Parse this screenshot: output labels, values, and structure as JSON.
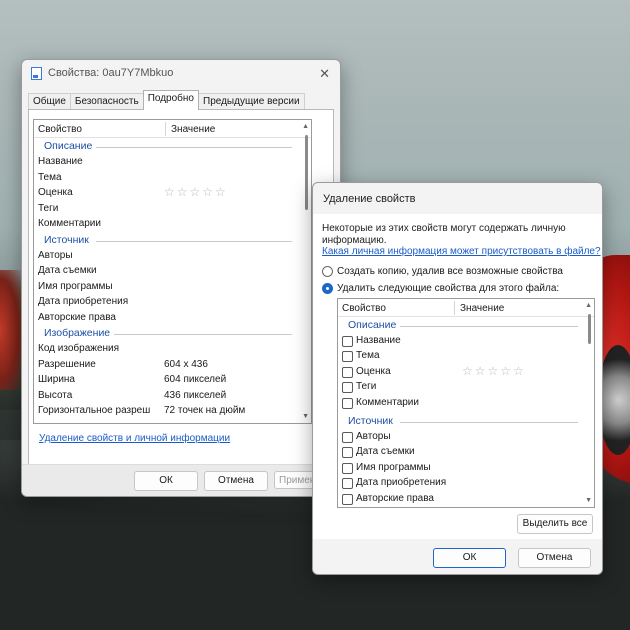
{
  "props_window": {
    "title": "Свойства: 0au7Y7Mbkuo",
    "tabs": [
      {
        "label": "Общие"
      },
      {
        "label": "Безопасность"
      },
      {
        "label": "Подробно"
      },
      {
        "label": "Предыдущие версии"
      }
    ],
    "active_tab": "Подробно",
    "columns": {
      "property": "Свойство",
      "value": "Значение"
    },
    "groups": [
      {
        "title": "Описание",
        "rows": [
          {
            "k": "Название",
            "v": ""
          },
          {
            "k": "Тема",
            "v": ""
          },
          {
            "k": "Оценка",
            "v": "☆☆☆☆☆"
          },
          {
            "k": "Теги",
            "v": ""
          },
          {
            "k": "Комментарии",
            "v": ""
          }
        ]
      },
      {
        "title": "Источник",
        "rows": [
          {
            "k": "Авторы",
            "v": ""
          },
          {
            "k": "Дата съемки",
            "v": ""
          },
          {
            "k": "Имя программы",
            "v": ""
          },
          {
            "k": "Дата приобретения",
            "v": ""
          },
          {
            "k": "Авторские права",
            "v": ""
          }
        ]
      },
      {
        "title": "Изображение",
        "rows": [
          {
            "k": "Код изображения",
            "v": ""
          },
          {
            "k": "Разрешение",
            "v": "604 x 436"
          },
          {
            "k": "Ширина",
            "v": "604 пикселей"
          },
          {
            "k": "Высота",
            "v": "436 пикселей"
          },
          {
            "k": "Горизонтальное разреш",
            "v": "72 точек на дюйм"
          }
        ]
      }
    ],
    "remove_link": "Удаление свойств и личной информации",
    "ok": "ОК",
    "cancel": "Отмена",
    "apply": "Примен"
  },
  "remove_dialog": {
    "title": "Удаление свойств",
    "note": "Некоторые из этих свойств могут содержать личную информацию.",
    "link": "Какая личная информация может присутствовать в файле?",
    "option_copy": "Создать копию, удалив все возможные свойства",
    "option_remove": "Удалить следующие свойства для этого файла:",
    "selected_option": "remove",
    "columns": {
      "property": "Свойство",
      "value": "Значение"
    },
    "groups": [
      {
        "title": "Описание",
        "rows": [
          {
            "k": "Название",
            "v": ""
          },
          {
            "k": "Тема",
            "v": ""
          },
          {
            "k": "Оценка",
            "v": "☆☆☆☆☆"
          },
          {
            "k": "Теги",
            "v": ""
          },
          {
            "k": "Комментарии",
            "v": ""
          }
        ]
      },
      {
        "title": "Источник",
        "rows": [
          {
            "k": "Авторы",
            "v": ""
          },
          {
            "k": "Дата съемки",
            "v": ""
          },
          {
            "k": "Имя программы",
            "v": ""
          },
          {
            "k": "Дата приобретения",
            "v": ""
          },
          {
            "k": "Авторские права",
            "v": ""
          }
        ]
      }
    ],
    "select_all": "Выделить все",
    "ok": "ОК",
    "cancel": "Отмена"
  },
  "colors": {
    "accent": "#1d67c9",
    "group_title": "#1d4fa6",
    "link": "#1a5cc8"
  }
}
